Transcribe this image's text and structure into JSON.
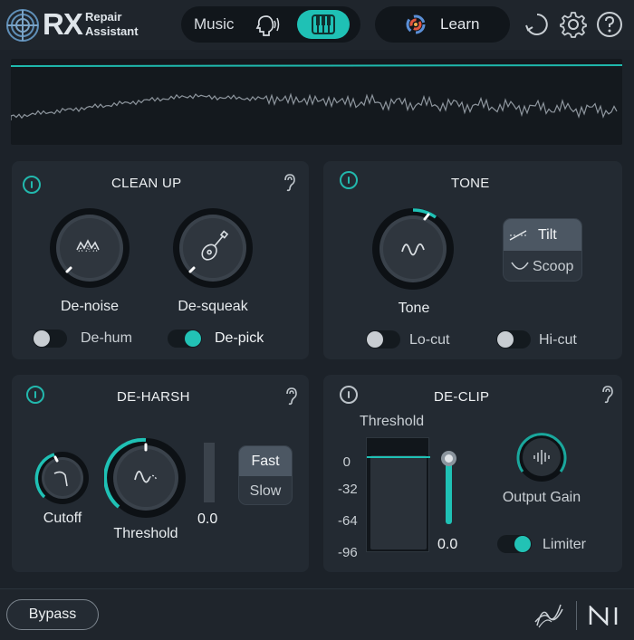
{
  "header": {
    "brand": "RX",
    "subtitle_line1": "Repair",
    "subtitle_line2": "Assistant",
    "music_label": "Music",
    "learn_label": "Learn",
    "icons": [
      "history-icon",
      "gear-icon",
      "help-icon"
    ],
    "accent": "#1fc1b5"
  },
  "cleanup": {
    "title": "CLEAN UP",
    "knobs": [
      "De-noise",
      "De-squeak"
    ],
    "toggles": [
      {
        "label": "De-hum",
        "on": false
      },
      {
        "label": "De-pick",
        "on": true
      }
    ]
  },
  "tone": {
    "title": "TONE",
    "knob": "Tone",
    "modes": [
      "Tilt",
      "Scoop"
    ],
    "selected_mode": "Tilt",
    "toggles": [
      {
        "label": "Lo-cut",
        "on": false
      },
      {
        "label": "Hi-cut",
        "on": false
      }
    ]
  },
  "deharsh": {
    "title": "DE-HARSH",
    "knobs": [
      "Cutoff",
      "Threshold"
    ],
    "value": "0.0",
    "speed": [
      "Fast",
      "Slow"
    ],
    "selected_speed": "Fast"
  },
  "declip": {
    "title": "DE-CLIP",
    "threshold_label": "Threshold",
    "scale": [
      "0",
      "-32",
      "-64",
      "-96"
    ],
    "value": "0.0",
    "output_gain_label": "Output Gain",
    "limiter_label": "Limiter",
    "limiter_on": true
  },
  "footer": {
    "bypass_label": "Bypass"
  }
}
